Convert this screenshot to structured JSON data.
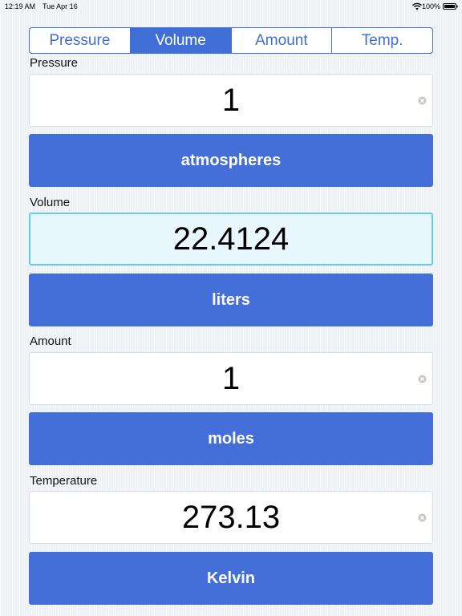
{
  "status_bar": {
    "time": "12:19 AM",
    "date": "Tue Apr 16",
    "battery_percent": "100%"
  },
  "tabs": [
    {
      "label": "Pressure",
      "selected": false
    },
    {
      "label": "Volume",
      "selected": true
    },
    {
      "label": "Amount",
      "selected": false
    },
    {
      "label": "Temp.",
      "selected": false
    }
  ],
  "pressure": {
    "label": "Pressure",
    "value": "1",
    "unit": "atmospheres"
  },
  "volume": {
    "label": "Volume",
    "value": "22.4124",
    "unit": "liters"
  },
  "amount": {
    "label": "Amount",
    "value": "1",
    "unit": "moles"
  },
  "temperature": {
    "label": "Temperature",
    "value": "273.13",
    "unit": "Kelvin"
  },
  "colors": {
    "accent": "#446ed8",
    "segment": "#3f6fd6",
    "active_field_bg": "#e8f6fd",
    "active_field_border": "#62cce6"
  },
  "icons": {
    "wifi": "wifi-icon",
    "battery": "battery-icon",
    "clear": "clear-icon"
  }
}
